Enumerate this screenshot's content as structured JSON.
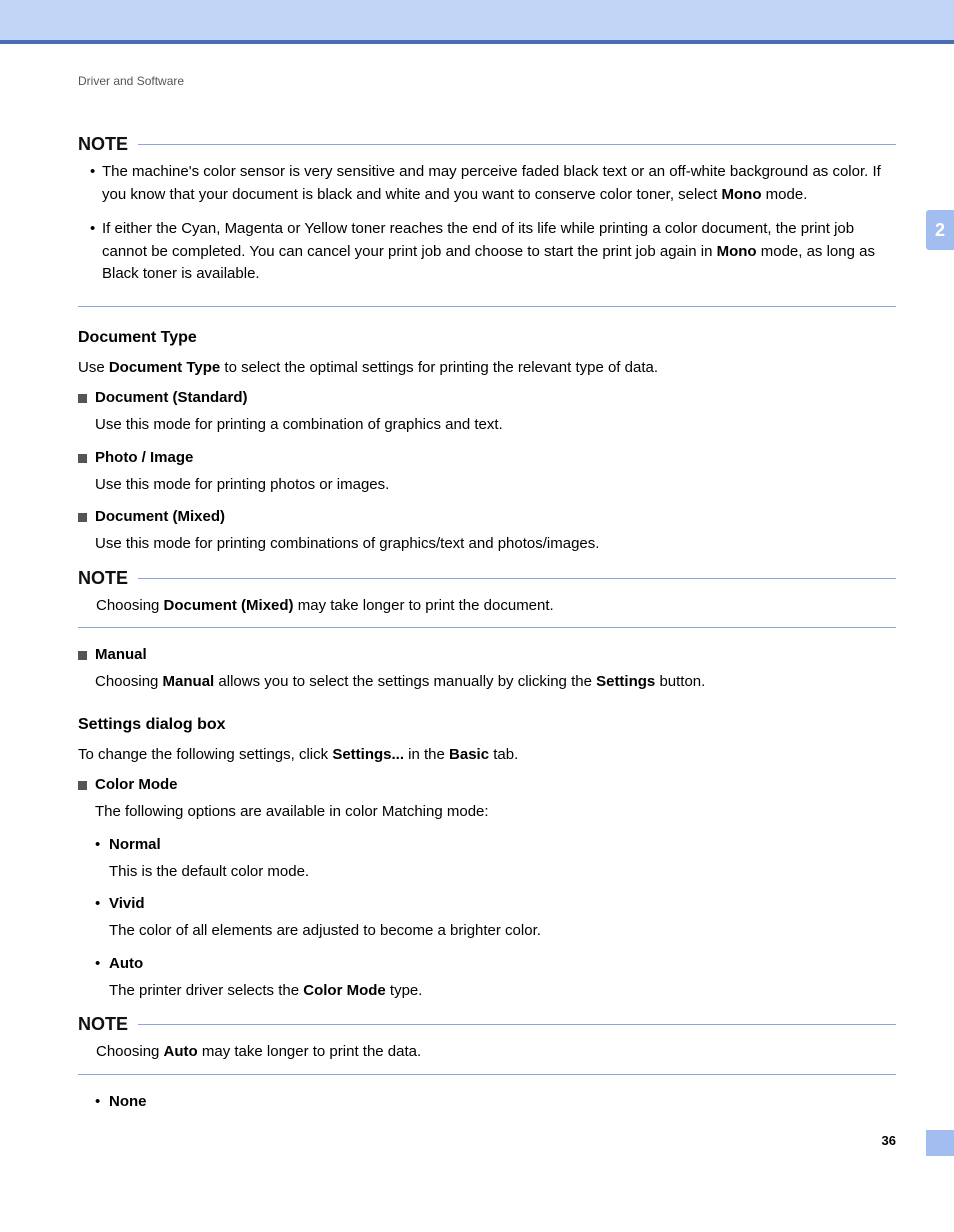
{
  "breadcrumb": "Driver and Software",
  "sectionNumber": "2",
  "pageNumber": "36",
  "noteLabel": "NOTE",
  "note1": {
    "b1a": "The machine's color sensor is very sensitive and may perceive faded black text or an off-white background as color. If you know that your document is black and white and you want to conserve color toner, select ",
    "b1b": "Mono",
    "b1c": " mode.",
    "b2a": "If either the Cyan, Magenta or Yellow toner reaches the end of its life while printing a color document, the print job cannot be completed. You can cancel your print job and choose to start the print job again in ",
    "b2b": "Mono",
    "b2c": " mode, as long as Black toner is available."
  },
  "docType": {
    "heading": "Document Type",
    "introA": "Use ",
    "introB": "Document Type",
    "introC": " to select the optimal settings for printing the relevant type of data.",
    "items": [
      {
        "title": "Document (Standard)",
        "desc": "Use this mode for printing a combination of graphics and text."
      },
      {
        "title": "Photo / Image",
        "desc": "Use this mode for printing photos or images."
      },
      {
        "title": "Document (Mixed)",
        "desc": "Use this mode for printing combinations of graphics/text and photos/images."
      }
    ]
  },
  "note2": {
    "a": "Choosing ",
    "b": "Document (Mixed)",
    "c": " may take longer to print the document."
  },
  "manual": {
    "title": "Manual",
    "a": "Choosing ",
    "b": "Manual",
    "c": " allows you to select the settings manually by clicking the ",
    "d": "Settings",
    "e": " button."
  },
  "settingsDialog": {
    "heading": "Settings dialog box",
    "introA": "To change the following settings, click ",
    "introB": "Settings...",
    "introC": " in the ",
    "introD": "Basic",
    "introE": " tab.",
    "colorMode": {
      "title": "Color Mode",
      "desc": "The following options are available in color Matching mode:",
      "opts": [
        {
          "title": "Normal",
          "desc": "This is the default color mode."
        },
        {
          "title": "Vivid",
          "desc": "The color of all elements are adjusted to become a brighter color."
        }
      ],
      "auto": {
        "title": "Auto",
        "a": "The printer driver selects the ",
        "b": "Color Mode",
        "c": " type."
      },
      "none": {
        "title": "None"
      }
    }
  },
  "note3": {
    "a": "Choosing ",
    "b": "Auto",
    "c": " may take longer to print the data."
  }
}
